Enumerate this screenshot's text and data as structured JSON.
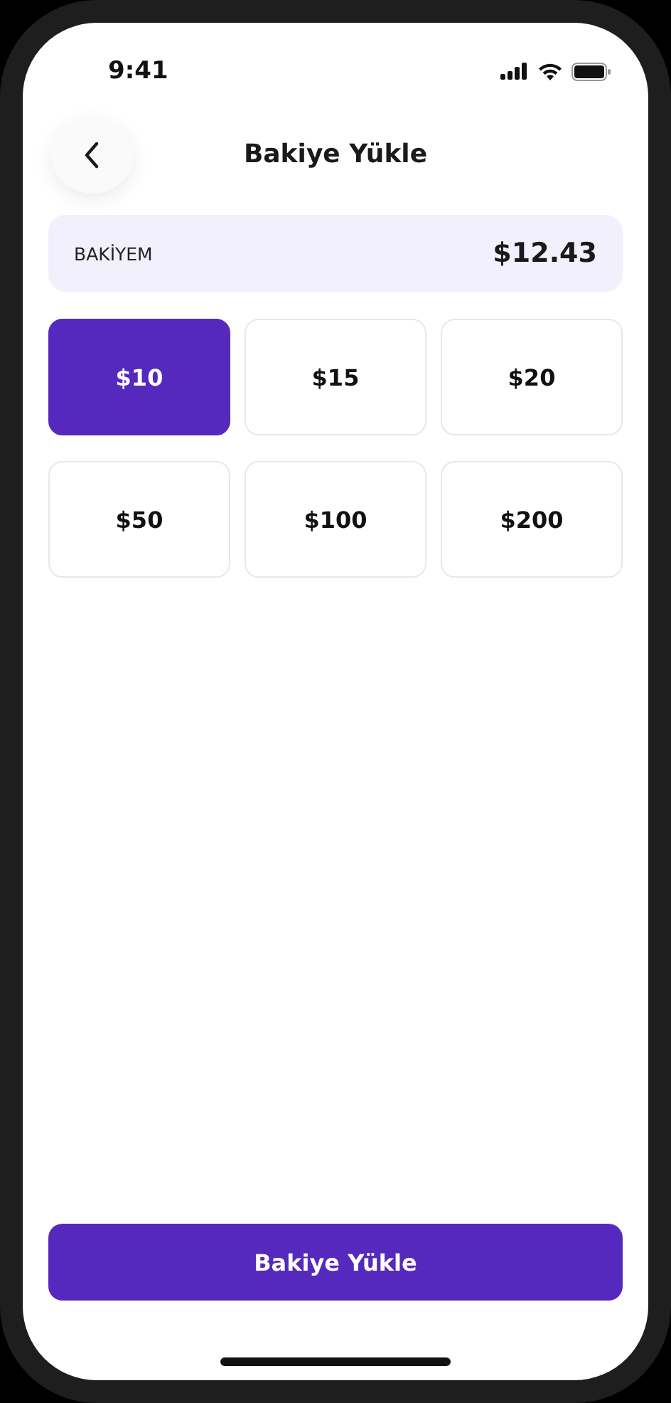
{
  "status_bar": {
    "time": "9:41"
  },
  "header": {
    "title": "Bakiye Yükle"
  },
  "balance": {
    "label": "BAKİYEM",
    "amount": "$12.43"
  },
  "amounts": [
    {
      "label": "$10",
      "selected": true
    },
    {
      "label": "$15",
      "selected": false
    },
    {
      "label": "$20",
      "selected": false
    },
    {
      "label": "$50",
      "selected": false
    },
    {
      "label": "$100",
      "selected": false
    },
    {
      "label": "$200",
      "selected": false
    }
  ],
  "primary_button": {
    "label": "Bakiye Yükle"
  }
}
